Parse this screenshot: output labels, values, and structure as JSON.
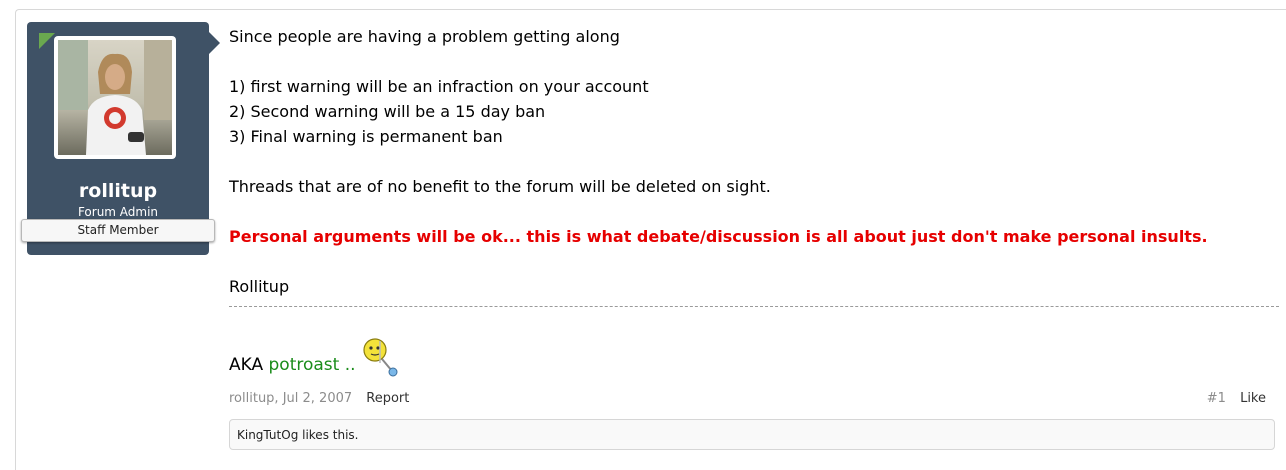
{
  "user": {
    "name": "rollitup",
    "title": "Forum Admin",
    "banner": "Staff Member"
  },
  "post": {
    "lines": [
      "Since people are having a problem getting along",
      "1) first warning will be an infraction on your account",
      "2) Second warning will be a 15 day ban",
      "3) Final warning is permanent ban",
      "Threads that are of no benefit to the forum will be deleted on sight.",
      "Personal arguments will be ok... this is what debate/discussion is all about just don't make personal insults.",
      "Rollitup"
    ]
  },
  "signature": {
    "prefix": "AKA",
    "name": "potroast ..",
    "icon": "smoking-smiley-icon"
  },
  "meta": {
    "author_date": "rollitup, Jul 2, 2007",
    "report": "Report",
    "post_number": "#1",
    "like": "Like"
  },
  "likes": {
    "text": "KingTutOg likes this."
  },
  "colors": {
    "user_card": "#3f5266",
    "warning_text": "#e60000",
    "signature_link": "#1a8c1a",
    "flag": "#6aa84f"
  }
}
